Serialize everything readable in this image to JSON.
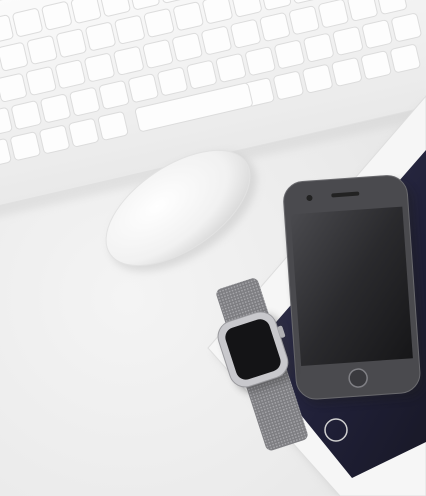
{
  "scene": {
    "objects": [
      {
        "id": "keyboard",
        "label": "keyboard"
      },
      {
        "id": "mouse",
        "label": "mouse"
      },
      {
        "id": "tablet",
        "label": "tablet"
      },
      {
        "id": "phone",
        "label": "phone"
      },
      {
        "id": "watch",
        "label": "watch"
      }
    ]
  },
  "colors": {
    "desk": "#ececec",
    "keyboard_body": "#f7f7f7",
    "key": "#fdfdfd",
    "mouse": "#fafafa",
    "tablet_frame": "#f5f5f5",
    "tablet_screen": "#23233a",
    "phone_body": "#3a3a3e",
    "phone_screen": "#1d1d20",
    "watch_band": "#8a8a8e",
    "watch_case": "#c8c8cc",
    "watch_screen": "#141416"
  }
}
